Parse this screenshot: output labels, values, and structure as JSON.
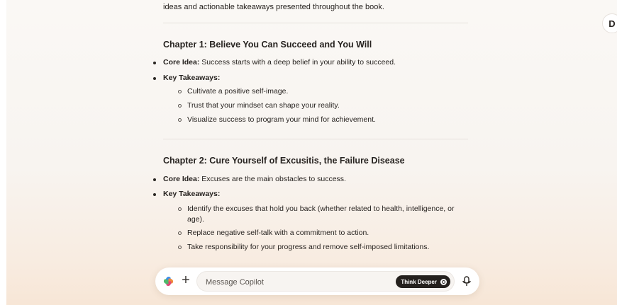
{
  "user": {
    "avatar_initial": "D"
  },
  "article": {
    "intro": "ideas and actionable takeaways presented throughout the book.",
    "chapters": [
      {
        "title": "Chapter 1: Believe You Can Succeed and You Will",
        "core_label": "Core Idea:",
        "core_text": " Success starts with a deep belief in your ability to succeed.",
        "takeaways_label": "Key Takeaways:",
        "takeaways": [
          "Cultivate a positive self-image.",
          "Trust that your mindset can shape your reality.",
          "Visualize success to program your mind for achievement."
        ]
      },
      {
        "title": "Chapter 2: Cure Yourself of Excusitis, the Failure Disease",
        "core_label": "Core Idea:",
        "core_text": " Excuses are the main obstacles to success.",
        "takeaways_label": "Key Takeaways:",
        "takeaways": [
          "Identify the excuses that hold you back (whether related to health, intelligence, or age).",
          "Replace negative self-talk with a commitment to action.",
          "Take responsibility for your progress and remove self-imposed limitations."
        ]
      }
    ]
  },
  "composer": {
    "placeholder": "Message Copilot",
    "think_deeper_label": "Think Deeper",
    "icons": {
      "logo": "copilot-logo-icon",
      "add": "plus-icon",
      "think": "think-deeper-icon",
      "mic": "microphone-icon"
    }
  }
}
